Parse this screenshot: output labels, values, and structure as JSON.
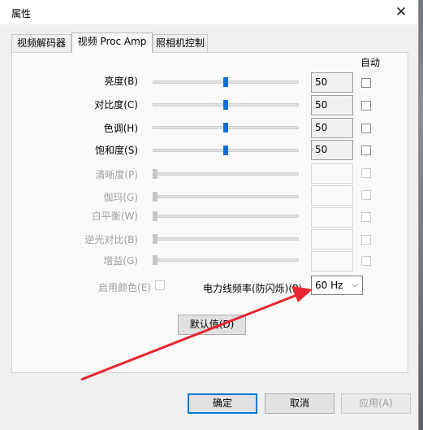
{
  "window": {
    "title": "属性",
    "close_glyph": "✕"
  },
  "tabs": [
    {
      "label": "视频解码器",
      "active": false
    },
    {
      "label": "视频 Proc Amp",
      "active": true
    },
    {
      "label": "照相机控制",
      "active": false
    }
  ],
  "auto_header": "自动",
  "controls": [
    {
      "label": "亮度(B)",
      "value": "50",
      "level": 0.5,
      "enabled": true,
      "auto": false
    },
    {
      "label": "对比度(C)",
      "value": "50",
      "level": 0.5,
      "enabled": true,
      "auto": false
    },
    {
      "label": "色调(H)",
      "value": "50",
      "level": 0.5,
      "enabled": true,
      "auto": false
    },
    {
      "label": "饱和度(S)",
      "value": "50",
      "level": 0.5,
      "enabled": true,
      "auto": false
    },
    {
      "label": "清晰度(P)",
      "value": "",
      "level": 0.0,
      "enabled": false,
      "auto": false
    },
    {
      "label": "伽玛(G)",
      "value": "",
      "level": 0.0,
      "enabled": false,
      "auto": false
    },
    {
      "label": "白平衡(W)",
      "value": "",
      "level": 0.0,
      "enabled": false,
      "auto": false
    },
    {
      "label": "逆光对比(B)",
      "value": "",
      "level": 0.0,
      "enabled": false,
      "auto": false
    },
    {
      "label": "增益(G)",
      "value": "",
      "level": 0.0,
      "enabled": false,
      "auto": false
    }
  ],
  "enable_color": {
    "label": "启用颜色(E)",
    "checked": false,
    "enabled": false
  },
  "powerline": {
    "label": "电力线频率(防闪烁)(P)",
    "selected": "60 Hz"
  },
  "default_button": "默认值(D)",
  "buttons": {
    "ok": "确定",
    "cancel": "取消",
    "apply": "应用(A)"
  },
  "annotation": {
    "color": "#e8262e"
  }
}
